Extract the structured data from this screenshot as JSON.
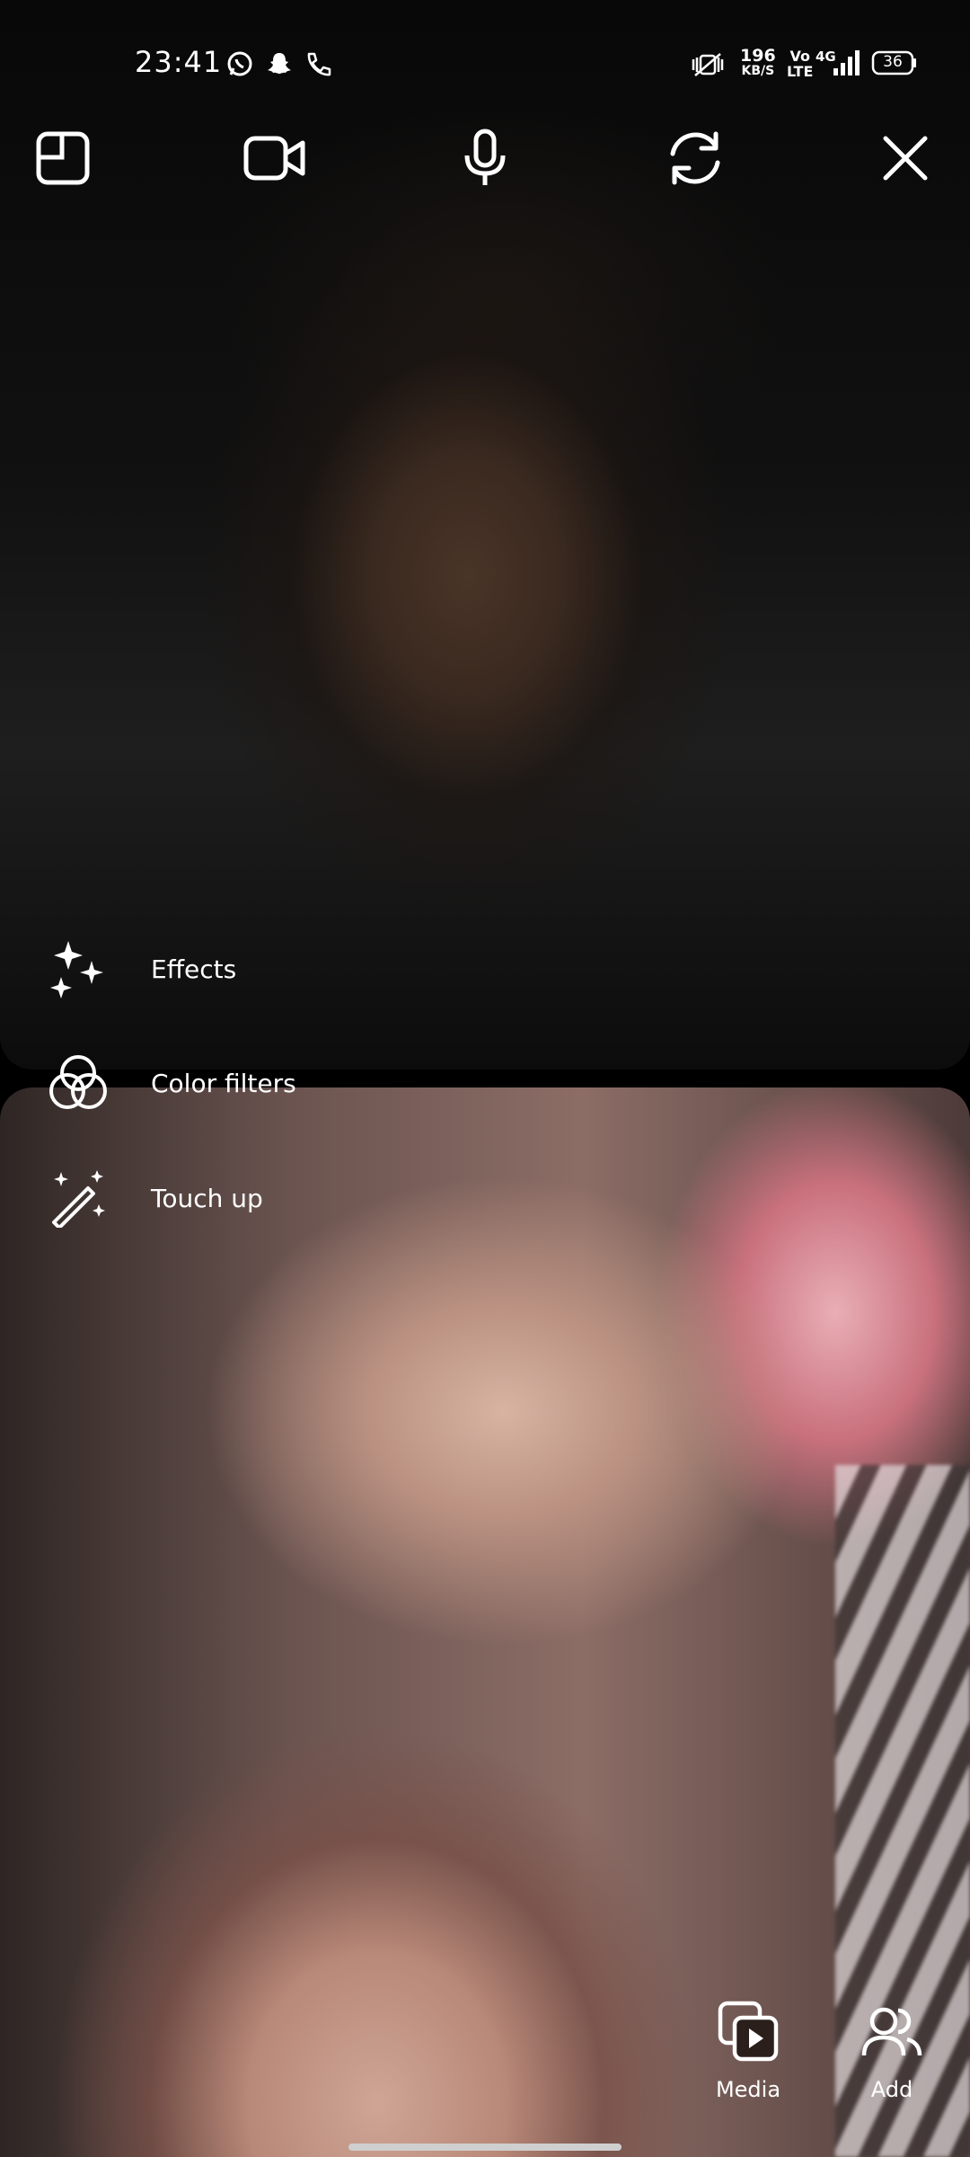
{
  "status_bar": {
    "time": "23:41",
    "notification_icons": [
      "whatsapp-icon",
      "snapchat-icon",
      "phone-icon"
    ],
    "net_speed_value": "196",
    "net_speed_unit": "KB/S",
    "volte_top": "Vo",
    "volte_bottom": "LTE",
    "network": "4G",
    "battery": "36"
  },
  "toolbar": {
    "icons": [
      "layout-icon",
      "video-camera-icon",
      "microphone-icon",
      "flip-camera-icon",
      "close-icon"
    ]
  },
  "effects_menu": {
    "items": [
      {
        "label": "Effects",
        "icon": "sparkles-icon"
      },
      {
        "label": "Color filters",
        "icon": "color-filters-icon"
      },
      {
        "label": "Touch up",
        "icon": "magic-wand-icon"
      }
    ]
  },
  "actions": {
    "media_label": "Media",
    "add_label": "Add"
  }
}
